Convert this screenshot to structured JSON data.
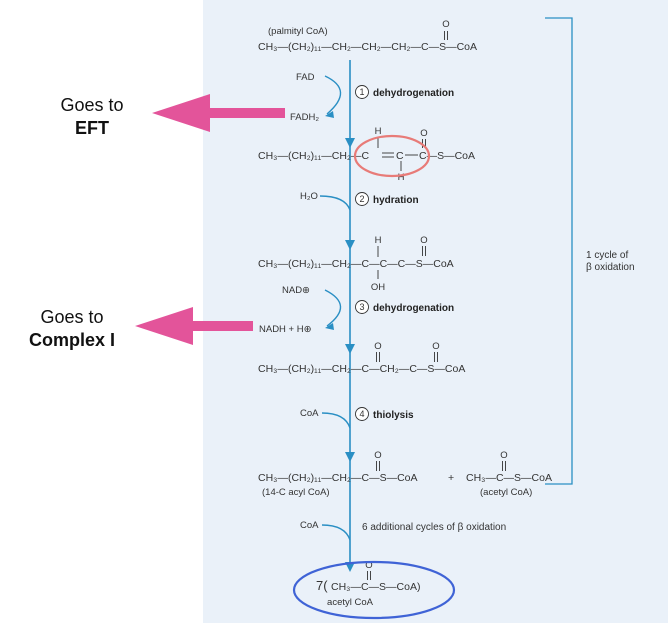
{
  "annotations": {
    "eft_line1": "Goes to",
    "eft_line2": "EFT",
    "complex_line1": "Goes to",
    "complex_line2": "Complex I"
  },
  "molecules": {
    "palmitoyl_label": "(palmityl CoA)",
    "palmitoyl": "CH₃—(CH₂)₁₁—CH₂—CH₂—CH₂—C—S—CoA",
    "enoyl_left": "CH₃—(CH₂)₁₁—CH₂—C",
    "enoyl_double": "C",
    "enoyl_right": "C—S—CoA",
    "enoyl_h": "H",
    "hydroxy_left": "CH₃—(CH₂)₁₁—CH₂—C—C—C—S—CoA",
    "hydroxy_h": "H",
    "hydroxy_oh": "OH",
    "keto": "CH₃—(CH₂)₁₁—CH₂—C—CH₂—C—S—CoA",
    "acyl14": "CH₃—(CH₂)₁₁—CH₂—C—S—CoA",
    "acyl14_label": "(14-C acyl CoA)",
    "plus": "+",
    "acetyl": "CH₃—C—S—CoA",
    "acetyl_label": "(acetyl CoA)",
    "final_coef": "7(",
    "final": "CH₃—C—S—CoA)",
    "final_label": "acetyl CoA",
    "carbonyl_o": "O"
  },
  "cofactors": {
    "fad": "FAD",
    "fadh2": "FADH₂",
    "h2o": "H₂O",
    "nad": "NAD⊕",
    "nadh": "NADH + H⊕",
    "coa1": "CoA",
    "coa2": "CoA"
  },
  "steps": [
    {
      "num": "1",
      "label": "dehydrogenation"
    },
    {
      "num": "2",
      "label": "hydration"
    },
    {
      "num": "3",
      "label": "dehydrogenation"
    },
    {
      "num": "4",
      "label": "thiolysis"
    }
  ],
  "additional": "6 additional cycles of β oxidation",
  "bracket_label_1": "1 cycle of",
  "bracket_label_2": "β oxidation",
  "colors": {
    "panel": "#eaf1f9",
    "arrow_blue": "#2a8fc4",
    "pink_arrow": "#e3549a",
    "highlight_red": "#e87b78",
    "highlight_blue": "#3f63d6"
  }
}
